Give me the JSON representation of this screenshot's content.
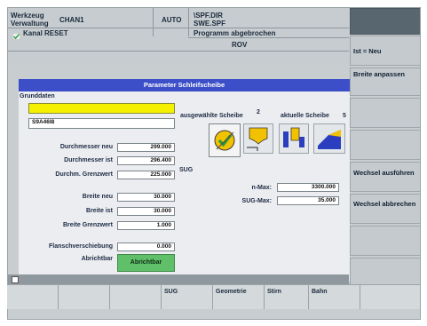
{
  "header": {
    "area": "Werkzeug Verwaltung",
    "channel": "CHAN1",
    "mode": "AUTO",
    "program_dir": "\\SPF.DIR",
    "program_file": "SWE.SPF",
    "reset_status": "Kanal RESET",
    "program_status": "Programm abgebrochen",
    "rov": "ROV"
  },
  "right_softkeys": [
    "Ist = Neu",
    "Breite anpassen",
    "",
    "",
    "Wechsel ausführen",
    "Wechsel abbrechen",
    "",
    ""
  ],
  "dialog": {
    "title": "Parameter Schleifscheibe",
    "section": "Grunddaten",
    "tool_name": "",
    "tool_id": "S9A46I8",
    "fields": [
      {
        "label": "Durchmesser neu",
        "value": "299.000"
      },
      {
        "label": "Durchmesser ist",
        "value": "296.400"
      },
      {
        "label": "Durchm. Grenzwert",
        "value": "225.000"
      },
      {
        "label": "Breite neu",
        "value": "30.000"
      },
      {
        "label": "Breite ist",
        "value": "30.000"
      },
      {
        "label": "Breite Grenzwert",
        "value": "1.000"
      },
      {
        "label": "Flanschverschiebung",
        "value": "0.000"
      }
    ],
    "dressable_label": "Abrichtbar",
    "dressable_value": "Abrichtbar",
    "selected_wheel_label": "ausgewählte Scheibe",
    "selected_wheel_value": "2",
    "current_wheel_label": "aktuelle Scheibe",
    "current_wheel_value": "5",
    "sug_label": "SUG",
    "nmax_label": "n-Max:",
    "nmax_value": "3300.000",
    "sugmax_label": "SUG-Max:",
    "sugmax_value": "35.000"
  },
  "bottom_softkeys": [
    "",
    "",
    "",
    "SUG",
    "Geometrie",
    "Stirn",
    "Bahn",
    ""
  ],
  "colors": {
    "title_bar": "#3c4ec8",
    "yellow_field": "#f4f000",
    "green_button": "#60c06a"
  }
}
